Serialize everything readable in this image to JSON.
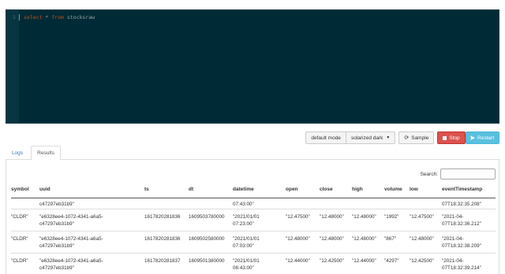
{
  "editor": {
    "line_number": "1",
    "keyword_select": "select",
    "operator": "*",
    "keyword_from": "from",
    "table_name": "stocksraw",
    "theme_bg": "#002b36"
  },
  "toolbar": {
    "mode_label": "default mode",
    "theme_label": "solarized dark",
    "sample_label": "Sample",
    "stop_label": "Stop",
    "restart_label": "Restart"
  },
  "tabs": {
    "logs": "Logs",
    "results": "Results"
  },
  "search": {
    "label": "Search:",
    "value": ""
  },
  "table": {
    "columns": [
      "symbol",
      "uuid",
      "ts",
      "dt",
      "datetime",
      "open",
      "close",
      "high",
      "volume",
      "low",
      "eventTimestamp"
    ],
    "partial_row": {
      "uuid_line2": "c47297eb31b9\"",
      "datetime_line2": "07:43:00\"",
      "eventTimestamp_line2": "07T18:32:35.208\""
    },
    "rows": [
      {
        "symbol": "\"CLDR\"",
        "uuid_line1": "\"e6328ee4-1072-4341-a6a5-",
        "uuid_line2": "c47297eb31b9\"",
        "ts": "1617820281836",
        "dt": "1609503780000",
        "datetime_line1": "\"2021/01/01",
        "datetime_line2": "07:23:00\"",
        "open": "\"12.47500\"",
        "close": "\"12.48000\"",
        "high": "\"12.48000\"",
        "volume": "\"1992\"",
        "low": "\"12.47500\"",
        "eventTimestamp_line1": "\"2021-04-",
        "eventTimestamp_line2": "07T18:32:36.212\""
      },
      {
        "symbol": "\"CLDR\"",
        "uuid_line1": "\"e6328ee4-1072-4341-a6a5-",
        "uuid_line2": "c47297eb31b9\"",
        "ts": "1617820281836",
        "dt": "1609502580000",
        "datetime_line1": "\"2021/01/01",
        "datetime_line2": "07:03:00\"",
        "open": "\"12.48000\"",
        "close": "\"12.48000\"",
        "high": "\"12.48000\"",
        "volume": "\"867\"",
        "low": "\"12.48000\"",
        "eventTimestamp_line1": "\"2021-04-",
        "eventTimestamp_line2": "07T18:32:38.209\""
      },
      {
        "symbol": "\"CLDR\"",
        "uuid_line1": "\"e6328ee4-1072-4341-a6a5-",
        "uuid_line2": "c47297eb31b9\"",
        "ts": "1617820281837",
        "dt": "1609501380000",
        "datetime_line1": "\"2021/01/01",
        "datetime_line2": "06:43:00\"",
        "open": "\"12.44000\"",
        "close": "\"12.42500\"",
        "high": "\"12.44000\"",
        "volume": "\"4297\"",
        "low": "\"12.42500\"",
        "eventTimestamp_line1": "\"2021-04-",
        "eventTimestamp_line2": "07T18:32:39.214\""
      }
    ]
  },
  "colors": {
    "stop": "#d9534f",
    "restart": "#5bc0de",
    "link": "#337ab7"
  }
}
